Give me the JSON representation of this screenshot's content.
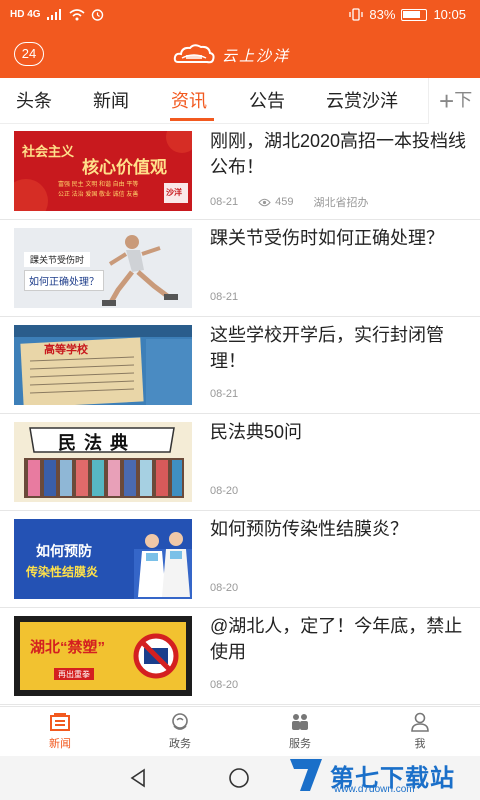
{
  "status_bar": {
    "left_icons": "HD 4G",
    "battery": "83%",
    "time": "10:05"
  },
  "header": {
    "counter": "24",
    "logo_text": "云上沙洋"
  },
  "tabs": [
    {
      "label": "头条"
    },
    {
      "label": "新闻"
    },
    {
      "label": "资讯",
      "active": true
    },
    {
      "label": "公告"
    },
    {
      "label": "云赏沙洋"
    }
  ],
  "tab_more": {
    "icon": "plus-icon",
    "label": "下"
  },
  "feed": [
    {
      "title": "刚刚，湖北2020高招一本投档线公布！",
      "date": "08-21",
      "views": "459",
      "source": "湖北省招办",
      "thumb": {
        "line1": "社会主义",
        "line2": "核心价值观",
        "line3": "富强 民主 文明 和谐 自由 平等",
        "line4": "公正 法治 爱国 敬业 诚信 友善",
        "badge": "沙洋"
      }
    },
    {
      "title": "踝关节受伤时如何正确处理？",
      "date": "08-21",
      "thumb": {
        "line1": "踝关节受伤时",
        "line2": "如何正确处理？"
      }
    },
    {
      "title": "这些学校开学后，实行封闭管理！",
      "date": "08-21",
      "thumb": {
        "line1": "高等学校"
      }
    },
    {
      "title": "民法典50问",
      "date": "08-20",
      "thumb": {
        "line1": "民法典"
      }
    },
    {
      "title": "如何预防传染性结膜炎？",
      "date": "08-20",
      "thumb": {
        "line1": "如何预防",
        "line2": "传染性结膜炎"
      }
    },
    {
      "title": "@湖北人，定了！今年底，禁止使用",
      "date": "08-20",
      "thumb": {
        "line1": "湖北“禁塑”",
        "line2": "再出重拳"
      }
    }
  ],
  "bottom_nav": [
    {
      "label": "新闻",
      "icon": "news-icon",
      "active": true
    },
    {
      "label": "政务",
      "icon": "government-icon"
    },
    {
      "label": "服务",
      "icon": "service-icon"
    },
    {
      "label": "我",
      "icon": "profile-icon"
    }
  ],
  "watermark": {
    "big": "第七下载站",
    "url": "www.d7down.com"
  },
  "colors": {
    "accent": "#f2591f",
    "watermark": "#1a6fc9"
  }
}
